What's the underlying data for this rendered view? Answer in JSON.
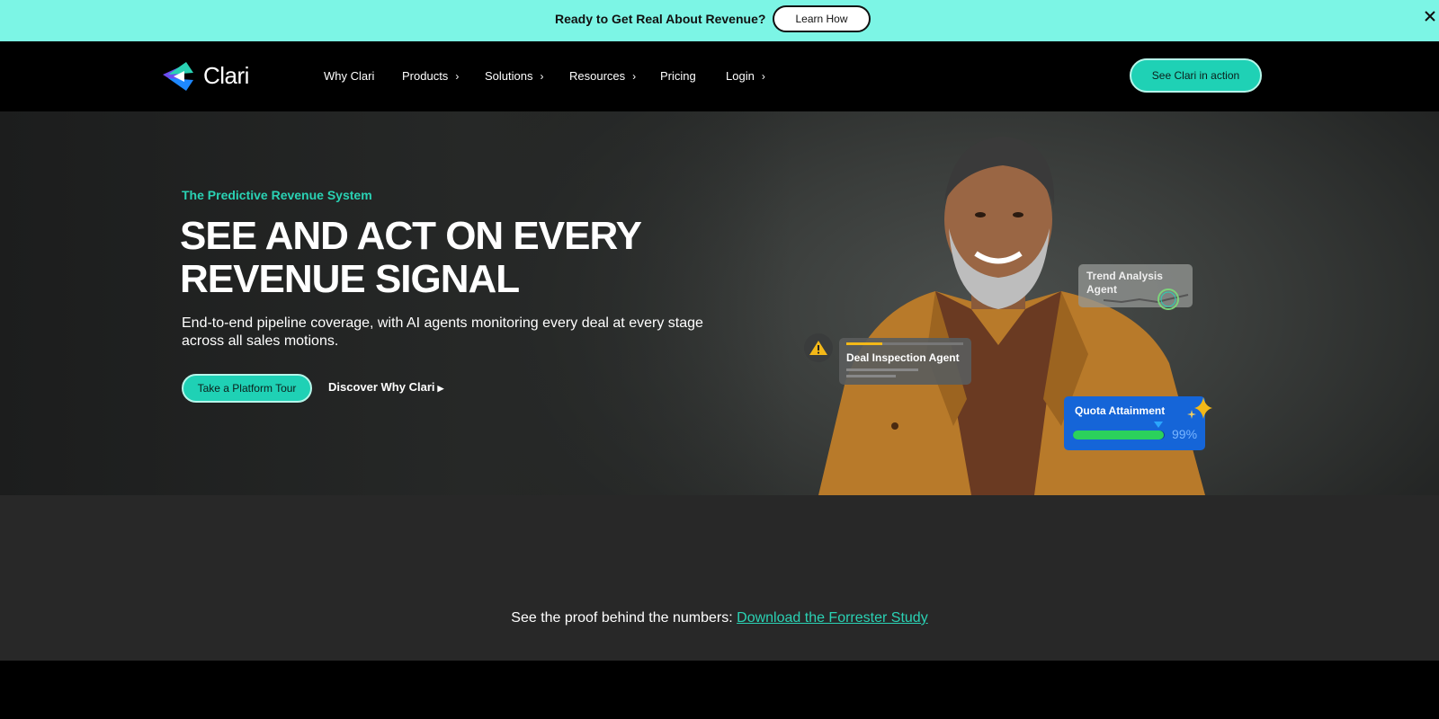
{
  "announcement": {
    "text": "Ready to Get Real About Revenue?",
    "button_label": "Learn How"
  },
  "nav": {
    "brand": "Clari",
    "items": [
      {
        "label": "Why Clari",
        "has_chevron": false
      },
      {
        "label": "Products",
        "has_chevron": true
      },
      {
        "label": "Solutions",
        "has_chevron": true
      },
      {
        "label": "Resources",
        "has_chevron": true
      },
      {
        "label": "Pricing",
        "has_chevron": false
      },
      {
        "label": "Login",
        "has_chevron": true
      }
    ],
    "cta_label": "See Clari in action"
  },
  "hero": {
    "eyebrow": "The Predictive Revenue System",
    "headline_line1": "SEE AND ACT ON EVERY",
    "headline_line2": "REVENUE SIGNAL",
    "subhead": "End-to-end pipeline coverage, with AI agents monitoring every deal at every stage across all sales motions.",
    "primary_button": "Take a Platform Tour",
    "secondary_button": "Discover Why Clari",
    "cards": {
      "deal_inspection": "Deal Inspection Agent",
      "trend_analysis": "Trend Analysis Agent",
      "quota_label": "Quota Attainment",
      "quota_percent": "99%",
      "quota_fraction": 0.99
    }
  },
  "proof": {
    "text": "See the proof behind the numbers: ",
    "link": "Download the Forrester Study"
  },
  "colors": {
    "accent": "#1fd1b5",
    "announcement_bg": "#7cf5e5",
    "quota_card": "#1565d8"
  }
}
